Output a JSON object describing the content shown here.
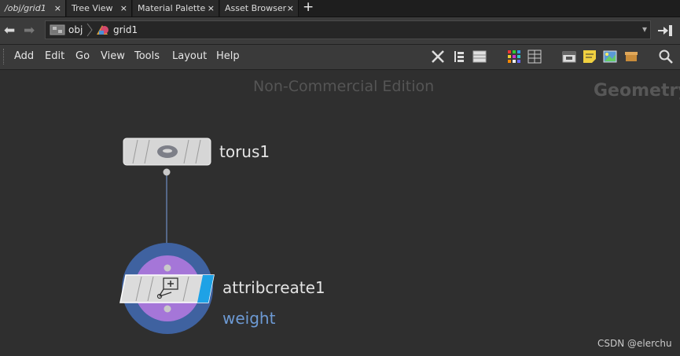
{
  "tabs": [
    {
      "label": "/obj/grid1",
      "close": "×"
    },
    {
      "label": "Tree View",
      "close": "×"
    },
    {
      "label": "Material Palette",
      "close": "×"
    },
    {
      "label": "Asset Browser",
      "close": "×"
    }
  ],
  "new_tab_label": "+",
  "path": {
    "back": "back-arrow-icon",
    "forward": "forward-arrow-icon",
    "crumbs": [
      "obj",
      "grid1"
    ],
    "dropdown": "▾"
  },
  "menu": [
    "Add",
    "Edit",
    "Go",
    "View",
    "Tools",
    "Layout",
    "Help"
  ],
  "network": {
    "watermark": "Non-Commercial Edition",
    "context_label": "Geometry",
    "nodes": [
      {
        "name": "torus1"
      },
      {
        "name": "attribcreate1",
        "parm": "weight"
      }
    ]
  },
  "credit": "CSDN @elerchu",
  "colors": {
    "background": "#2f2f2f",
    "select_ring": "#3f62a0",
    "node_ring": "#a576d8",
    "display_flag": "#1ea2e6"
  }
}
